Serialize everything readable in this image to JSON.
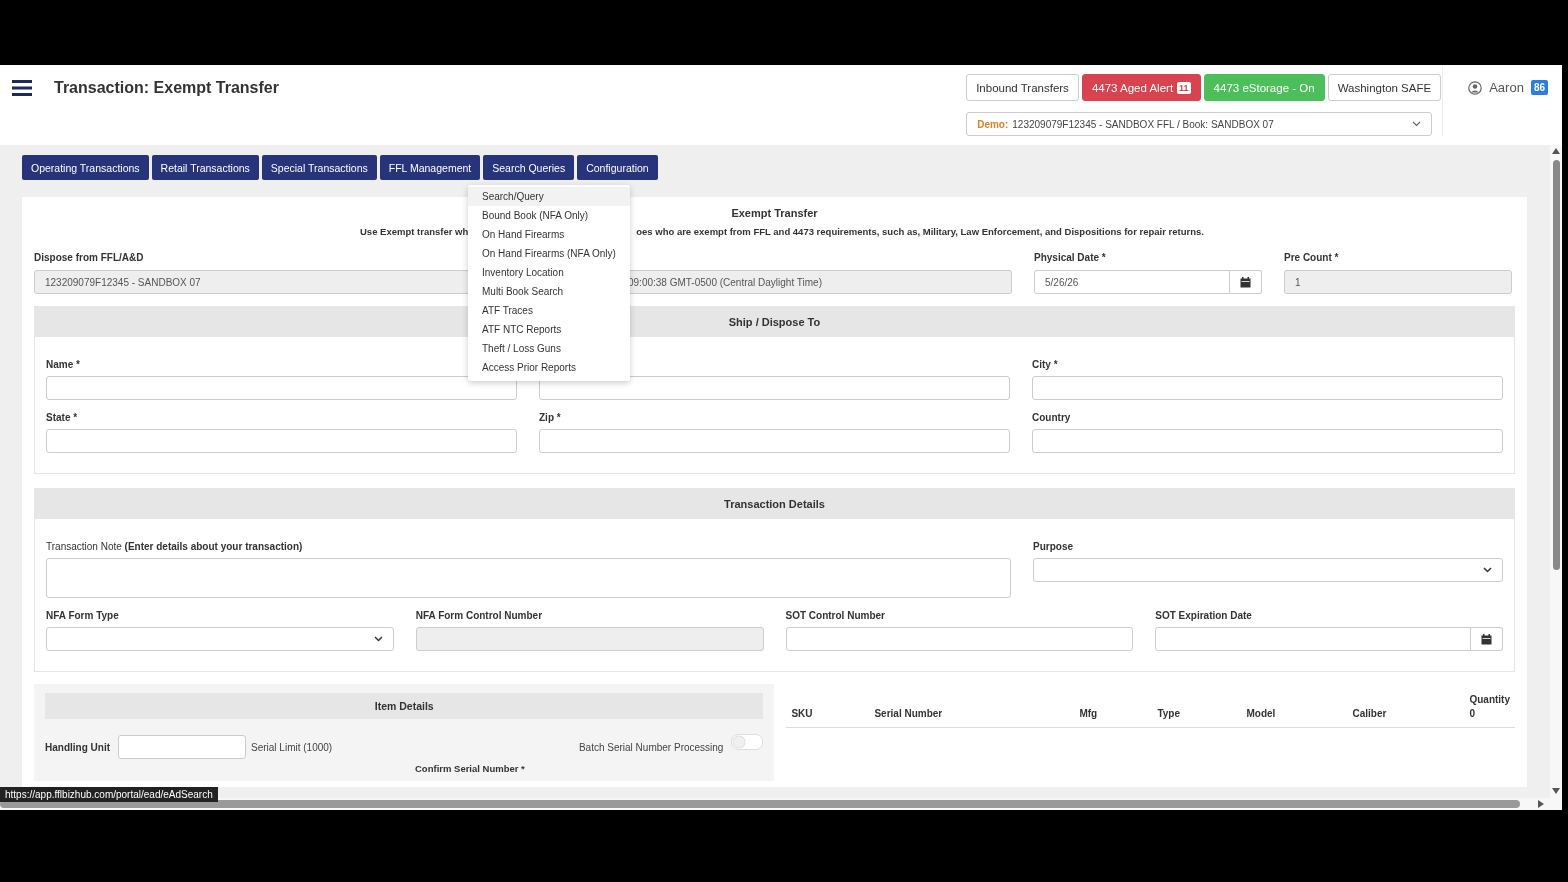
{
  "header": {
    "title": "Transaction: Exempt Transfer",
    "buttons": [
      {
        "label": "Inbound Transfers",
        "kind": "plain"
      },
      {
        "label": "4473 Aged Alert",
        "kind": "danger",
        "badge": "11"
      },
      {
        "label": "4473 eStorage - On",
        "kind": "success"
      },
      {
        "label": "Washington SAFE",
        "kind": "plain"
      }
    ],
    "user": {
      "name": "Aaron",
      "badge": "86"
    },
    "book_select": {
      "prefix": "Demo:",
      "value": "123209079F12345 - SANDBOX FFL / Book: SANDBOX 07"
    }
  },
  "nav": [
    "Operating Transactions",
    "Retail Transactions",
    "Special Transactions",
    "FFL Management",
    "Search Queries",
    "Configuration"
  ],
  "menu": [
    {
      "label": "Search/Query",
      "selected": true
    },
    {
      "label": "Bound Book (NFA Only)",
      "selected": false
    },
    {
      "label": "On Hand Firearms",
      "selected": false
    },
    {
      "label": "On Hand Firearms (NFA Only)",
      "selected": false
    },
    {
      "label": "Inventory Location",
      "selected": false
    },
    {
      "label": "Multi Book Search",
      "selected": false
    },
    {
      "label": "ATF Traces",
      "selected": false
    },
    {
      "label": "ATF NTC Reports",
      "selected": false
    },
    {
      "label": "Theft / Loss Guns",
      "selected": false
    },
    {
      "label": "Access Prior Reports",
      "selected": false
    }
  ],
  "form": {
    "title": "Exempt Transfer",
    "description_parts": [
      "Use Exempt transfer wh",
      "oes who are exempt from FFL and 4473 requirements, such as, Military, Law Enforcement, and Dispositions for repair returns."
    ],
    "top_fields": [
      {
        "label": "Dispose from FFL/A&D",
        "value": "123209079F12345 - SANDBOX 07",
        "kind": "readonly"
      },
      {
        "value": "09:00:38 GMT-0500 (Central Daylight Time)",
        "kind": "readonly"
      },
      {
        "label": "Physical Date *",
        "value": "5/26/26",
        "kind": "date"
      },
      {
        "label": "Pre Count *",
        "value": "1",
        "kind": "readonly"
      }
    ],
    "ship": {
      "title": "Ship / Dispose To",
      "fields": [
        {
          "label": "Name *",
          "kind": "text"
        },
        {
          "kind": "text"
        },
        {
          "label": "City *",
          "kind": "text"
        },
        {
          "label": "State *",
          "kind": "text"
        },
        {
          "label": "Zip *",
          "kind": "text"
        },
        {
          "label": "Country",
          "kind": "text"
        }
      ]
    },
    "details": {
      "title": "Transaction Details",
      "note_label": "Transaction Note **(Enter details about your transaction)**",
      "purpose_label": "Purpose",
      "fields": [
        {
          "label": "NFA Form Type",
          "kind": "select"
        },
        {
          "label": "NFA Form Control Number",
          "kind": "readonly"
        },
        {
          "label": "SOT Control Number",
          "kind": "text"
        },
        {
          "label": "SOT Expiration Date",
          "kind": "date"
        }
      ]
    }
  },
  "items": {
    "title": "Item Details",
    "handling_label": "Handling Unit",
    "serial_limit": "Serial Limit (1000)",
    "batch": {
      "label": "Batch Serial Number Processing",
      "on": false
    },
    "confirm_label": "Confirm Serial Number *",
    "columns": [
      {
        "label": "SKU"
      },
      {
        "label": "Serial Number"
      },
      {
        "label": "Mfg"
      },
      {
        "label": "Type"
      },
      {
        "label": "Model"
      },
      {
        "label": "Caliber"
      },
      {
        "label": "Quantity",
        "sub": "0"
      }
    ]
  },
  "status_url": "https://app.fflbizhub.com/portal/ead/eAdSearch"
}
